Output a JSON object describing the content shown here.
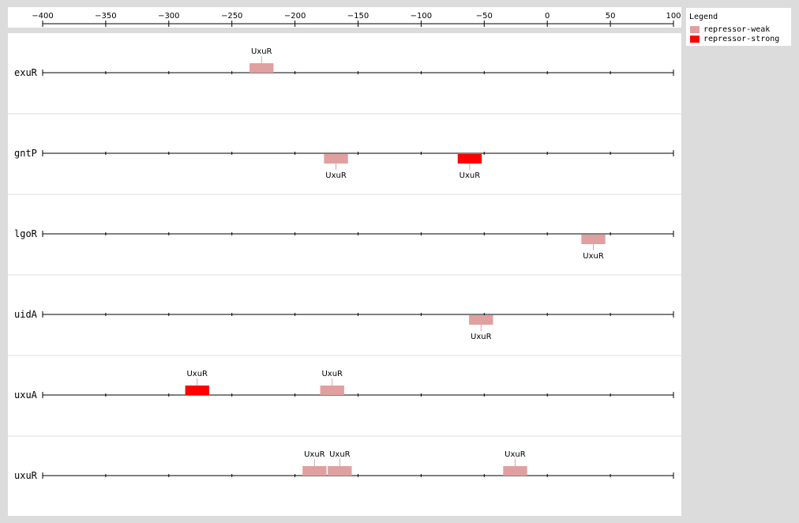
{
  "scale": {
    "min": -400,
    "max": 100,
    "labels": [
      "−400",
      "−350",
      "−300",
      "−250",
      "−200",
      "−150",
      "−100",
      "−50",
      "0",
      "50",
      "100"
    ]
  },
  "legend": {
    "title": "Legend",
    "items": [
      {
        "label": "repressor-weak",
        "color": "#e0a0a0"
      },
      {
        "label": "repressor-strong",
        "color": "#ff0000"
      }
    ]
  },
  "tracks": [
    {
      "name": "exuR",
      "sites": [
        {
          "label": "UxuR",
          "start": -236,
          "end": -217,
          "type": "weak",
          "side": "above"
        }
      ]
    },
    {
      "name": "gntP",
      "sites": [
        {
          "label": "UxuR",
          "start": -177,
          "end": -158,
          "type": "weak",
          "side": "below"
        },
        {
          "label": "UxuR",
          "start": -71,
          "end": -52,
          "type": "strong",
          "side": "below"
        }
      ]
    },
    {
      "name": "lgoR",
      "sites": [
        {
          "label": "UxuR",
          "start": 27,
          "end": 46,
          "type": "weak",
          "side": "below"
        }
      ]
    },
    {
      "name": "uidA",
      "sites": [
        {
          "label": "UxuR",
          "start": -62,
          "end": -43,
          "type": "weak",
          "side": "below"
        }
      ]
    },
    {
      "name": "uxuA",
      "sites": [
        {
          "label": "UxuR",
          "start": -287,
          "end": -268,
          "type": "strong",
          "side": "above"
        },
        {
          "label": "UxuR",
          "start": -180,
          "end": -161,
          "type": "weak",
          "side": "above"
        }
      ]
    },
    {
      "name": "uxuR",
      "sites": [
        {
          "label": "UxuR",
          "start": -194,
          "end": -175,
          "type": "weak",
          "side": "above"
        },
        {
          "label": "UxuR",
          "start": -174,
          "end": -155,
          "type": "weak",
          "side": "above"
        },
        {
          "label": "UxuR",
          "start": -35,
          "end": -16,
          "type": "weak",
          "side": "above"
        }
      ]
    }
  ]
}
